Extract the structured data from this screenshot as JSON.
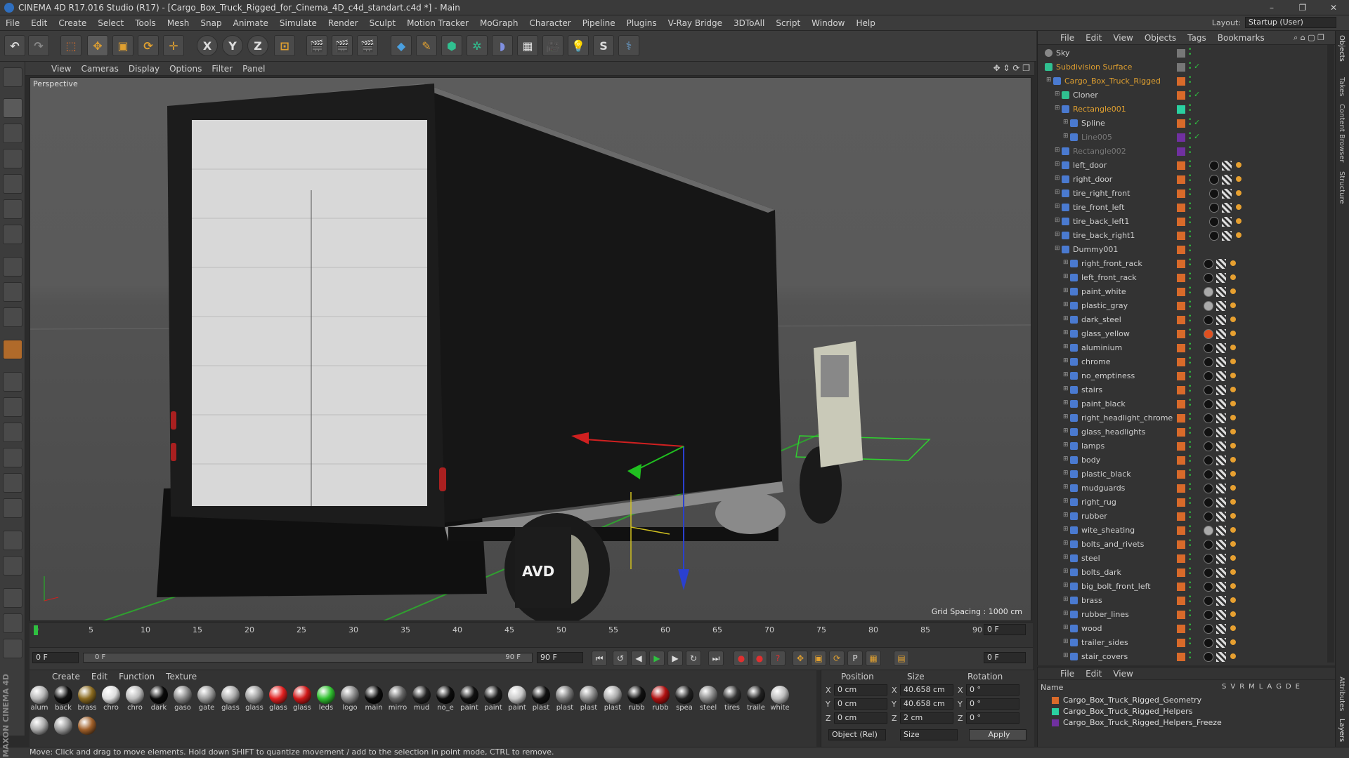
{
  "window": {
    "title": "CINEMA 4D R17.016 Studio (R17) - [Cargo_Box_Truck_Rigged_for_Cinema_4D_c4d_standart.c4d *] - Main",
    "minimize": "–",
    "maximize": "❐",
    "close": "✕"
  },
  "menubar": [
    "File",
    "Edit",
    "Create",
    "Select",
    "Tools",
    "Mesh",
    "Snap",
    "Animate",
    "Simulate",
    "Render",
    "Sculpt",
    "Motion Tracker",
    "MoGraph",
    "Character",
    "Pipeline",
    "Plugins",
    "V-Ray Bridge",
    "3DToAll",
    "Script",
    "Window",
    "Help"
  ],
  "layout": {
    "label": "Layout:",
    "value": "Startup (User)"
  },
  "toolbar": {
    "x_label": "X",
    "y_label": "Y",
    "z_label": "Z"
  },
  "viewport": {
    "menu": [
      "View",
      "Cameras",
      "Display",
      "Options",
      "Filter",
      "Panel"
    ],
    "label": "Perspective",
    "grid_spacing": "Grid Spacing : 1000 cm",
    "truck_plate": "AVD"
  },
  "timeline": {
    "ticks": [
      "0",
      "5",
      "10",
      "15",
      "20",
      "25",
      "30",
      "35",
      "40",
      "45",
      "50",
      "55",
      "60",
      "65",
      "70",
      "75",
      "80",
      "85",
      "90"
    ],
    "current_frame": "0 F",
    "start_field": "0 F",
    "range_start": "0 F",
    "range_end": "90 F",
    "end_field": "90 F",
    "min_field": "0 F"
  },
  "materials": {
    "menu": [
      "Create",
      "Edit",
      "Function",
      "Texture"
    ],
    "items": [
      {
        "label": "alum",
        "color": "#b5b5b5"
      },
      {
        "label": "back",
        "color": "#111"
      },
      {
        "label": "brass",
        "color": "#8a6a20"
      },
      {
        "label": "chro",
        "color": "#ddd"
      },
      {
        "label": "chro",
        "color": "#bbb"
      },
      {
        "label": "dark",
        "color": "#0a0a0a"
      },
      {
        "label": "gaso",
        "color": "#888"
      },
      {
        "label": "gate",
        "color": "#999"
      },
      {
        "label": "glass",
        "color": "#aaa"
      },
      {
        "label": "glass",
        "color": "#9a9a9a"
      },
      {
        "label": "glass",
        "color": "#e02020"
      },
      {
        "label": "glass",
        "color": "#d01818"
      },
      {
        "label": "leds",
        "color": "#30c030"
      },
      {
        "label": "logo",
        "color": "#888"
      },
      {
        "label": "main",
        "color": "#0c0c0c"
      },
      {
        "label": "mirro",
        "color": "#666"
      },
      {
        "label": "mud",
        "color": "#222"
      },
      {
        "label": "no_e",
        "color": "#0c0c0c"
      },
      {
        "label": "paint",
        "color": "#111"
      },
      {
        "label": "paint",
        "color": "#1a1a1a"
      },
      {
        "label": "paint",
        "color": "#c8c8c8"
      },
      {
        "label": "plast",
        "color": "#111"
      },
      {
        "label": "plast",
        "color": "#777"
      },
      {
        "label": "plast",
        "color": "#888"
      },
      {
        "label": "plast",
        "color": "#aaa"
      },
      {
        "label": "rubb",
        "color": "#111"
      },
      {
        "label": "rubb",
        "color": "#b01010"
      },
      {
        "label": "spea",
        "color": "#222"
      },
      {
        "label": "steel",
        "color": "#888"
      },
      {
        "label": "tires",
        "color": "#333"
      },
      {
        "label": "traile",
        "color": "#222"
      },
      {
        "label": "white",
        "color": "#bbb"
      },
      {
        "label": "",
        "color": "#aaa"
      },
      {
        "label": "",
        "color": "#999"
      },
      {
        "label": "",
        "color": "#a0602a"
      }
    ]
  },
  "coords": {
    "headers": [
      "Position",
      "Size",
      "Rotation"
    ],
    "rows": [
      {
        "axis": "X",
        "pos": "0 cm",
        "size_axis": "X",
        "size": "40.658 cm",
        "rot_axis": "X",
        "rot": "0 °"
      },
      {
        "axis": "Y",
        "pos": "0 cm",
        "size_axis": "Y",
        "size": "40.658 cm",
        "rot_axis": "Y",
        "rot": "0 °"
      },
      {
        "axis": "Z",
        "pos": "0 cm",
        "size_axis": "Z",
        "size": "2 cm",
        "rot_axis": "Z",
        "rot": "0 °"
      }
    ],
    "mode_select": "Object (Rel)",
    "size_select": "Size",
    "apply": "Apply"
  },
  "status": "Move: Click and drag to move elements. Hold down SHIFT to quantize movement / add to the selection in point mode, CTRL to remove.",
  "objects": {
    "menu": [
      "File",
      "Edit",
      "View",
      "Objects",
      "Tags",
      "Bookmarks"
    ],
    "rows": [
      {
        "name": "Sky",
        "indent": 0,
        "color": "#cfcfcf"
      },
      {
        "name": "Subdivision Surface",
        "indent": 0,
        "color": "#e0a030"
      },
      {
        "name": "Cargo_Box_Truck_Rigged",
        "indent": 1,
        "color": "#e0a030"
      },
      {
        "name": "Cloner",
        "indent": 2,
        "color": "#cfcfcf"
      },
      {
        "name": "Rectangle001",
        "indent": 2,
        "color": "#e0a030"
      },
      {
        "name": "Spline",
        "indent": 3,
        "color": "#cfcfcf"
      },
      {
        "name": "Line005",
        "indent": 3,
        "color": "#777"
      },
      {
        "name": "Rectangle002",
        "indent": 2,
        "color": "#777"
      },
      {
        "name": "left_door",
        "indent": 2,
        "color": "#cfcfcf"
      },
      {
        "name": "right_door",
        "indent": 2,
        "color": "#cfcfcf"
      },
      {
        "name": "tire_right_front",
        "indent": 2,
        "color": "#cfcfcf"
      },
      {
        "name": "tire_front_left",
        "indent": 2,
        "color": "#cfcfcf"
      },
      {
        "name": "tire_back_left1",
        "indent": 2,
        "color": "#cfcfcf"
      },
      {
        "name": "tire_back_right1",
        "indent": 2,
        "color": "#cfcfcf"
      },
      {
        "name": "Dummy001",
        "indent": 2,
        "color": "#cfcfcf"
      },
      {
        "name": "right_front_rack",
        "indent": 3,
        "color": "#cfcfcf"
      },
      {
        "name": "left_front_rack",
        "indent": 3,
        "color": "#cfcfcf"
      },
      {
        "name": "paint_white",
        "indent": 3,
        "color": "#cfcfcf"
      },
      {
        "name": "plastic_gray",
        "indent": 3,
        "color": "#cfcfcf"
      },
      {
        "name": "dark_steel",
        "indent": 3,
        "color": "#cfcfcf"
      },
      {
        "name": "glass_yellow",
        "indent": 3,
        "color": "#cfcfcf"
      },
      {
        "name": "aluminium",
        "indent": 3,
        "color": "#cfcfcf"
      },
      {
        "name": "chrome",
        "indent": 3,
        "color": "#cfcfcf"
      },
      {
        "name": "no_emptiness",
        "indent": 3,
        "color": "#cfcfcf"
      },
      {
        "name": "stairs",
        "indent": 3,
        "color": "#cfcfcf"
      },
      {
        "name": "paint_black",
        "indent": 3,
        "color": "#cfcfcf"
      },
      {
        "name": "right_headlight_chrome",
        "indent": 3,
        "color": "#cfcfcf"
      },
      {
        "name": "glass_headlights",
        "indent": 3,
        "color": "#cfcfcf"
      },
      {
        "name": "lamps",
        "indent": 3,
        "color": "#cfcfcf"
      },
      {
        "name": "body",
        "indent": 3,
        "color": "#cfcfcf"
      },
      {
        "name": "plastic_black",
        "indent": 3,
        "color": "#cfcfcf"
      },
      {
        "name": "mudguards",
        "indent": 3,
        "color": "#cfcfcf"
      },
      {
        "name": "right_rug",
        "indent": 3,
        "color": "#cfcfcf"
      },
      {
        "name": "rubber",
        "indent": 3,
        "color": "#cfcfcf"
      },
      {
        "name": "wite_sheating",
        "indent": 3,
        "color": "#cfcfcf"
      },
      {
        "name": "bolts_and_rivets",
        "indent": 3,
        "color": "#cfcfcf"
      },
      {
        "name": "steel",
        "indent": 3,
        "color": "#cfcfcf"
      },
      {
        "name": "bolts_dark",
        "indent": 3,
        "color": "#cfcfcf"
      },
      {
        "name": "big_bolt_front_left",
        "indent": 3,
        "color": "#cfcfcf"
      },
      {
        "name": "brass",
        "indent": 3,
        "color": "#cfcfcf"
      },
      {
        "name": "rubber_lines",
        "indent": 3,
        "color": "#cfcfcf"
      },
      {
        "name": "wood",
        "indent": 3,
        "color": "#cfcfcf"
      },
      {
        "name": "trailer_sides",
        "indent": 3,
        "color": "#cfcfcf"
      },
      {
        "name": "stair_covers",
        "indent": 3,
        "color": "#cfcfcf"
      }
    ]
  },
  "layers": {
    "menu": [
      "File",
      "Edit",
      "View"
    ],
    "header_name": "Name",
    "header_cols": [
      "S",
      "V",
      "R",
      "M",
      "L",
      "A",
      "G",
      "D",
      "E"
    ],
    "rows": [
      {
        "name": "Cargo_Box_Truck_Rigged_Geometry",
        "color": "#d96a2a"
      },
      {
        "name": "Cargo_Box_Truck_Rigged_Helpers",
        "color": "#2ad0a0"
      },
      {
        "name": "Cargo_Box_Truck_Rigged_Helpers_Freeze",
        "color": "#7030a0"
      }
    ]
  },
  "sidetabs": [
    "Objects",
    "Takes",
    "Content Browser",
    "Structure",
    "Attributes",
    "Layers"
  ],
  "brand": "MAXON CINEMA 4D"
}
